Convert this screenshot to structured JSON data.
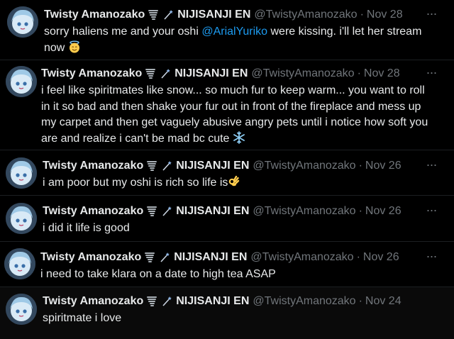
{
  "author": {
    "name": "Twisty Amanozako",
    "org": "NIJISANJI EN",
    "handle": "@TwistyAmanozako"
  },
  "tweets": [
    {
      "date": "Nov 28",
      "text_before": "sorry haliens me and your oshi ",
      "mention": "@ArialYuriko",
      "text_after": " were kissing. i'll let her stream now",
      "emoji": "smiling-face-with-halo"
    },
    {
      "date": "Nov 28",
      "text": "i feel like spiritmates like snow... so much fur to keep warm... you want to roll in it so bad and then shake your fur out in front of the fireplace and mess up my carpet and then get vaguely abusive angry pets until i notice how soft you are and realize i can't be mad bc cute",
      "emoji": "snowflake"
    },
    {
      "date": "Nov 26",
      "text": "i am poor but my oshi is rich so life is",
      "emoji": "ok-hand"
    },
    {
      "date": "Nov 26",
      "text": "i did it life is good"
    },
    {
      "date": "Nov 26",
      "text": "i need to take klara on a date to high tea ASAP"
    },
    {
      "date": "Nov 24",
      "text": "spiritmate i love"
    }
  ],
  "icons": {
    "badge_1": "tornado-icon",
    "badge_2": "wand-icon",
    "more": "more-options-icon"
  },
  "colors": {
    "background": "#000000",
    "text": "#e7e9ea",
    "muted": "#71767b",
    "link": "#1d9bf0"
  },
  "separator": "·",
  "more_glyph": "···"
}
